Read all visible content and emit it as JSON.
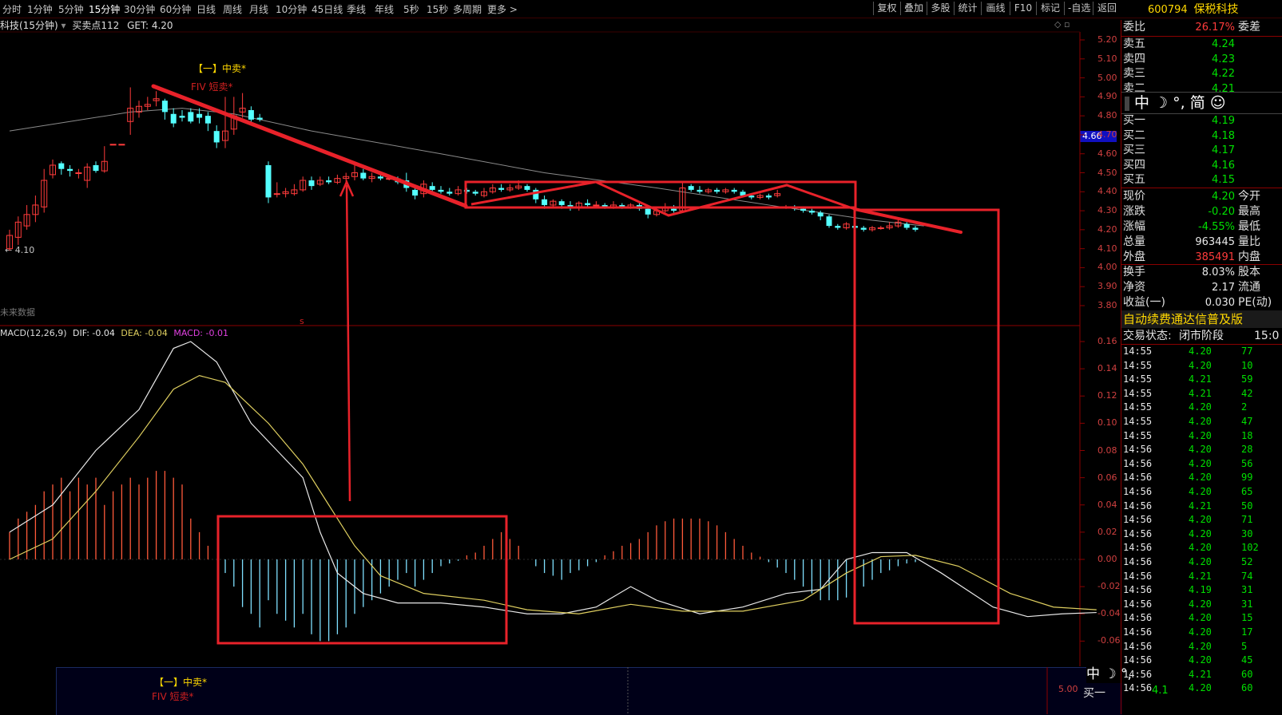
{
  "toolbar": {
    "periods": [
      "分时",
      "1分钟",
      "5分钟",
      "15分钟",
      "30分钟",
      "60分钟",
      "日线",
      "周线",
      "月线",
      "10分钟",
      "45日线",
      "季线",
      "年线",
      "5秒",
      "15秒",
      "多周期",
      "更多 >"
    ],
    "active_period": "15分钟",
    "tools": [
      "复权",
      "叠加",
      "多股",
      "统计",
      "画线",
      "F10",
      "标记",
      "-自选",
      "返回"
    ]
  },
  "stock": {
    "code": "600794",
    "name": "保税科技"
  },
  "chart": {
    "title": "科技(15分钟)",
    "indicator_label": "买卖点112",
    "get_label": "GET: 4.20",
    "low_mark": "4.10",
    "future_label": "未来数据",
    "signal_zhongmai": "【一】中卖*",
    "signal_duanmai": "FIV 短卖*",
    "price_tag": "4.66",
    "marker_s": "s",
    "price_axis": [
      "5.20",
      "5.10",
      "5.00",
      "4.90",
      "4.80",
      "4.70",
      "4.60",
      "4.50",
      "4.40",
      "4.30",
      "4.20",
      "4.10",
      "4.00",
      "3.90",
      "3.80"
    ],
    "macd_title": "MACD(12,26,9)",
    "dif": "DIF: -0.04",
    "dea": "DEA: -0.04",
    "macd": "MACD: -0.01",
    "macd_axis": [
      "0.16",
      "0.14",
      "0.12",
      "0.10",
      "0.08",
      "0.06",
      "0.04",
      "0.02",
      "0.00",
      "-0.02",
      "-0.04",
      "-0.06"
    ],
    "bottom_signal": "【一】中卖*",
    "bottom_signal2": "FIV 短卖*",
    "bottom_axis": "5.00",
    "bottom_mini": "中 ☽ °,",
    "bottom_buy1": "买一",
    "bottom_buy1_val": "4.1"
  },
  "colors": {
    "up": "#ff3b3b",
    "down": "#54ffff",
    "annotation": "#e8222a",
    "macd_dif": "#e8e8e8",
    "macd_dea": "#e0d060"
  },
  "candles": [
    [
      4.1,
      4.17,
      4.2,
      4.09
    ],
    [
      4.16,
      4.24,
      4.27,
      4.12
    ],
    [
      4.22,
      4.28,
      4.33,
      4.2
    ],
    [
      4.28,
      4.33,
      4.38,
      4.24
    ],
    [
      4.32,
      4.46,
      4.52,
      4.29
    ],
    [
      4.49,
      4.54,
      4.57,
      4.47
    ],
    [
      4.55,
      4.52,
      4.56,
      4.49
    ],
    [
      4.52,
      4.51,
      4.54,
      4.48
    ],
    [
      4.5,
      4.5,
      4.52,
      4.47
    ],
    [
      4.46,
      4.53,
      4.55,
      4.42
    ],
    [
      4.54,
      4.51,
      4.56,
      4.5
    ],
    [
      4.51,
      4.56,
      4.64,
      4.5
    ],
    [
      4.65,
      4.65,
      4.65,
      4.65
    ],
    [
      4.65,
      4.65,
      4.65,
      4.65
    ],
    [
      4.77,
      4.84,
      4.95,
      4.7
    ],
    [
      4.82,
      4.85,
      4.88,
      4.79
    ],
    [
      4.85,
      4.86,
      4.9,
      4.83
    ],
    [
      4.88,
      4.89,
      4.93,
      4.85
    ],
    [
      4.88,
      4.82,
      4.89,
      4.78
    ],
    [
      4.81,
      4.76,
      4.84,
      4.74
    ],
    [
      4.8,
      4.79,
      4.83,
      4.77
    ],
    [
      4.82,
      4.77,
      4.84,
      4.76
    ],
    [
      4.81,
      4.79,
      4.84,
      4.76
    ],
    [
      4.8,
      4.76,
      4.82,
      4.72
    ],
    [
      4.72,
      4.66,
      4.75,
      4.63
    ],
    [
      4.67,
      4.72,
      4.9,
      4.63
    ],
    [
      4.73,
      4.8,
      4.9,
      4.7
    ],
    [
      4.82,
      4.84,
      4.92,
      4.79
    ],
    [
      4.83,
      4.78,
      4.85,
      4.75
    ],
    [
      4.79,
      4.78,
      4.81,
      4.77
    ],
    [
      4.54,
      4.37,
      4.56,
      4.34
    ],
    [
      4.39,
      4.39,
      4.45,
      4.37
    ],
    [
      4.39,
      4.4,
      4.42,
      4.37
    ],
    [
      4.39,
      4.41,
      4.44,
      4.38
    ],
    [
      4.41,
      4.46,
      4.48,
      4.4
    ],
    [
      4.46,
      4.43,
      4.48,
      4.41
    ],
    [
      4.44,
      4.46,
      4.48,
      4.43
    ],
    [
      4.46,
      4.45,
      4.48,
      4.44
    ],
    [
      4.45,
      4.47,
      4.49,
      4.44
    ],
    [
      4.47,
      4.48,
      4.5,
      4.45
    ],
    [
      4.48,
      4.5,
      4.54,
      4.46
    ],
    [
      4.5,
      4.47,
      4.52,
      4.46
    ],
    [
      4.47,
      4.48,
      4.5,
      4.45
    ],
    [
      4.48,
      4.47,
      4.5,
      4.46
    ],
    [
      4.47,
      4.47,
      4.49,
      4.46
    ],
    [
      4.47,
      4.45,
      4.48,
      4.44
    ],
    [
      4.46,
      4.42,
      4.5,
      4.4
    ],
    [
      4.41,
      4.38,
      4.43,
      4.36
    ],
    [
      4.39,
      4.44,
      4.46,
      4.37
    ],
    [
      4.43,
      4.41,
      4.45,
      4.4
    ],
    [
      4.41,
      4.4,
      4.43,
      4.39
    ],
    [
      4.4,
      4.39,
      4.42,
      4.38
    ],
    [
      4.39,
      4.41,
      4.43,
      4.38
    ],
    [
      4.41,
      4.4,
      4.42,
      4.39
    ],
    [
      4.4,
      4.39,
      4.41,
      4.38
    ],
    [
      4.38,
      4.4,
      4.42,
      4.37
    ],
    [
      4.4,
      4.42,
      4.44,
      4.39
    ],
    [
      4.42,
      4.41,
      4.44,
      4.4
    ],
    [
      4.41,
      4.42,
      4.44,
      4.4
    ],
    [
      4.42,
      4.43,
      4.46,
      4.41
    ],
    [
      4.43,
      4.41,
      4.44,
      4.4
    ],
    [
      4.41,
      4.36,
      4.42,
      4.34
    ],
    [
      4.36,
      4.33,
      4.38,
      4.31
    ],
    [
      4.33,
      4.35,
      4.36,
      4.32
    ],
    [
      4.35,
      4.33,
      4.36,
      4.31
    ],
    [
      4.33,
      4.32,
      4.35,
      4.3
    ],
    [
      4.32,
      4.34,
      4.35,
      4.3
    ],
    [
      4.34,
      4.33,
      4.36,
      4.32
    ],
    [
      4.33,
      4.33,
      4.35,
      4.32
    ],
    [
      4.33,
      4.32,
      4.34,
      4.31
    ],
    [
      4.32,
      4.33,
      4.35,
      4.31
    ],
    [
      4.33,
      4.32,
      4.34,
      4.31
    ],
    [
      4.32,
      4.33,
      4.34,
      4.31
    ],
    [
      4.33,
      4.31,
      4.34,
      4.3
    ],
    [
      4.31,
      4.28,
      4.32,
      4.26
    ],
    [
      4.28,
      4.3,
      4.32,
      4.27
    ],
    [
      4.3,
      4.32,
      4.34,
      4.29
    ],
    [
      4.31,
      4.3,
      4.33,
      4.29
    ],
    [
      4.3,
      4.42,
      4.45,
      4.29
    ],
    [
      4.43,
      4.41,
      4.44,
      4.4
    ],
    [
      4.41,
      4.4,
      4.43,
      4.39
    ],
    [
      4.4,
      4.41,
      4.42,
      4.39
    ],
    [
      4.41,
      4.4,
      4.42,
      4.39
    ],
    [
      4.4,
      4.41,
      4.42,
      4.39
    ],
    [
      4.41,
      4.4,
      4.42,
      4.39
    ],
    [
      4.4,
      4.38,
      4.41,
      4.37
    ],
    [
      4.38,
      4.37,
      4.39,
      4.36
    ],
    [
      4.37,
      4.38,
      4.39,
      4.36
    ],
    [
      4.38,
      4.37,
      4.39,
      4.36
    ],
    [
      4.38,
      4.39,
      4.41,
      4.37
    ],
    [
      4.32,
      4.32,
      4.33,
      4.31
    ],
    [
      4.32,
      4.31,
      4.33,
      4.3
    ],
    [
      4.31,
      4.3,
      4.32,
      4.29
    ],
    [
      4.3,
      4.29,
      4.31,
      4.28
    ],
    [
      4.29,
      4.27,
      4.3,
      4.25
    ],
    [
      4.27,
      4.22,
      4.28,
      4.21
    ],
    [
      4.22,
      4.21,
      4.23,
      4.2
    ],
    [
      4.21,
      4.23,
      4.24,
      4.2
    ],
    [
      4.22,
      4.21,
      4.23,
      4.2
    ],
    [
      4.21,
      4.2,
      4.22,
      4.19
    ],
    [
      4.2,
      4.21,
      4.22,
      4.19
    ],
    [
      4.21,
      4.21,
      4.22,
      4.2
    ],
    [
      4.21,
      4.22,
      4.24,
      4.2
    ],
    [
      4.22,
      4.24,
      4.26,
      4.21
    ],
    [
      4.23,
      4.21,
      4.24,
      4.2
    ],
    [
      4.21,
      4.2,
      4.22,
      4.19
    ]
  ],
  "ma_line": [
    [
      0,
      4.72
    ],
    [
      7,
      4.77
    ],
    [
      14,
      4.82
    ],
    [
      20,
      4.84
    ],
    [
      26,
      4.81
    ],
    [
      35,
      4.72
    ],
    [
      50,
      4.6
    ],
    [
      62,
      4.5
    ],
    [
      75,
      4.42
    ],
    [
      88,
      4.33
    ],
    [
      100,
      4.25
    ],
    [
      106,
      4.22
    ]
  ],
  "macd_hist": [
    0.02,
    0.03,
    0.035,
    0.04,
    0.05,
    0.055,
    0.06,
    0.05,
    0.06,
    0.055,
    0.06,
    0.04,
    0.05,
    0.055,
    0.06,
    0.055,
    0.06,
    0.065,
    0.065,
    0.06,
    0.055,
    0.03,
    0.02,
    0.01,
    0.0,
    -0.01,
    -0.02,
    -0.035,
    -0.04,
    -0.05,
    -0.03,
    -0.04,
    -0.045,
    -0.05,
    -0.04,
    -0.055,
    -0.06,
    -0.06,
    -0.055,
    -0.05,
    -0.04,
    -0.035,
    -0.03,
    -0.025,
    -0.02,
    -0.015,
    -0.01,
    -0.02,
    -0.015,
    -0.01,
    -0.005,
    -0.003,
    -0.001,
    0.003,
    0.005,
    0.01,
    0.015,
    0.02,
    0.015,
    0.01,
    0.0,
    -0.005,
    -0.01,
    -0.012,
    -0.015,
    -0.01,
    -0.008,
    -0.005,
    -0.002,
    0.003,
    0.006,
    0.01,
    0.012,
    0.015,
    0.02,
    0.025,
    0.028,
    0.03,
    0.03,
    0.03,
    0.03,
    0.028,
    0.025,
    0.02,
    0.015,
    0.01,
    0.005,
    0.002,
    -0.002,
    -0.006,
    -0.01,
    -0.015,
    -0.02,
    -0.025,
    -0.03,
    -0.03,
    -0.03,
    -0.028,
    -0.025,
    -0.02,
    -0.015,
    -0.01,
    -0.008,
    -0.005,
    -0.003,
    -0.002
  ],
  "dif": [
    [
      0,
      0.02
    ],
    [
      5,
      0.04
    ],
    [
      10,
      0.08
    ],
    [
      15,
      0.11
    ],
    [
      19,
      0.155
    ],
    [
      21,
      0.16
    ],
    [
      24,
      0.145
    ],
    [
      28,
      0.1
    ],
    [
      31,
      0.08
    ],
    [
      34,
      0.06
    ],
    [
      36,
      0.02
    ],
    [
      38,
      -0.01
    ],
    [
      41,
      -0.025
    ],
    [
      45,
      -0.032
    ],
    [
      50,
      -0.032
    ],
    [
      55,
      -0.035
    ],
    [
      60,
      -0.04
    ],
    [
      64,
      -0.04
    ],
    [
      68,
      -0.035
    ],
    [
      72,
      -0.02
    ],
    [
      75,
      -0.03
    ],
    [
      80,
      -0.04
    ],
    [
      85,
      -0.035
    ],
    [
      90,
      -0.025
    ],
    [
      94,
      -0.022
    ],
    [
      97,
      0.0
    ],
    [
      100,
      0.005
    ],
    [
      104,
      0.005
    ],
    [
      108,
      -0.01
    ],
    [
      114,
      -0.035
    ],
    [
      118,
      -0.042
    ],
    [
      122,
      -0.04
    ],
    [
      126,
      -0.039
    ]
  ],
  "dea": [
    [
      0,
      0.0
    ],
    [
      5,
      0.015
    ],
    [
      10,
      0.05
    ],
    [
      15,
      0.09
    ],
    [
      19,
      0.125
    ],
    [
      22,
      0.135
    ],
    [
      25,
      0.13
    ],
    [
      30,
      0.1
    ],
    [
      34,
      0.07
    ],
    [
      37,
      0.04
    ],
    [
      40,
      0.01
    ],
    [
      43,
      -0.012
    ],
    [
      48,
      -0.025
    ],
    [
      55,
      -0.03
    ],
    [
      60,
      -0.037
    ],
    [
      66,
      -0.04
    ],
    [
      72,
      -0.033
    ],
    [
      78,
      -0.038
    ],
    [
      85,
      -0.038
    ],
    [
      92,
      -0.03
    ],
    [
      97,
      -0.01
    ],
    [
      101,
      0.002
    ],
    [
      105,
      0.003
    ],
    [
      110,
      -0.005
    ],
    [
      116,
      -0.025
    ],
    [
      121,
      -0.035
    ],
    [
      126,
      -0.037
    ]
  ],
  "orderbook": {
    "weibi": {
      "label": "委比",
      "value": "26.17%",
      "label2": "委差"
    },
    "sells": [
      {
        "label": "卖五",
        "price": "4.24"
      },
      {
        "label": "卖四",
        "price": "4.23"
      },
      {
        "label": "卖三",
        "price": "4.22"
      },
      {
        "label": "卖二",
        "price": "4.21"
      }
    ],
    "ime": "中 ☽ °, 简 ☺",
    "buys": [
      {
        "label": "买一",
        "price": "4.19"
      },
      {
        "label": "买二",
        "price": "4.18"
      },
      {
        "label": "买三",
        "price": "4.17"
      },
      {
        "label": "买四",
        "price": "4.16"
      },
      {
        "label": "买五",
        "price": "4.15"
      }
    ]
  },
  "quote": [
    {
      "k": "现价",
      "v": "4.20",
      "c": "green",
      "k2": "今开"
    },
    {
      "k": "涨跌",
      "v": "-0.20",
      "c": "green",
      "k2": "最高"
    },
    {
      "k": "涨幅",
      "v": "-4.55%",
      "c": "green",
      "k2": "最低"
    },
    {
      "k": "总量",
      "v": "963445",
      "c": "white",
      "k2": "量比"
    },
    {
      "k": "外盘",
      "v": "385491",
      "c": "redt",
      "k2": "内盘"
    },
    {
      "k": "换手",
      "v": "8.03%",
      "c": "white",
      "k2": "股本"
    },
    {
      "k": "净资",
      "v": "2.17",
      "c": "white",
      "k2": "流通"
    },
    {
      "k": "收益(一)",
      "v": "0.030",
      "c": "white",
      "k2": "PE(动)"
    }
  ],
  "banner": "自动续费通达信普及版",
  "trade_status": {
    "label": "交易状态:",
    "value": "闭市阶段",
    "time": "15:0"
  },
  "ticks": [
    {
      "t": "14:55",
      "p": "4.20",
      "v": "77",
      "c": "green"
    },
    {
      "t": "14:55",
      "p": "4.20",
      "v": "10",
      "c": "green"
    },
    {
      "t": "14:55",
      "p": "4.21",
      "v": "59",
      "c": "green"
    },
    {
      "t": "14:55",
      "p": "4.21",
      "v": "42",
      "c": "green"
    },
    {
      "t": "14:55",
      "p": "4.20",
      "v": "2",
      "c": "green"
    },
    {
      "t": "14:55",
      "p": "4.20",
      "v": "47",
      "c": "green"
    },
    {
      "t": "14:55",
      "p": "4.20",
      "v": "18",
      "c": "green"
    },
    {
      "t": "14:56",
      "p": "4.20",
      "v": "28",
      "c": "green"
    },
    {
      "t": "14:56",
      "p": "4.20",
      "v": "56",
      "c": "green"
    },
    {
      "t": "14:56",
      "p": "4.20",
      "v": "99",
      "c": "green"
    },
    {
      "t": "14:56",
      "p": "4.20",
      "v": "65",
      "c": "green"
    },
    {
      "t": "14:56",
      "p": "4.21",
      "v": "50",
      "c": "green"
    },
    {
      "t": "14:56",
      "p": "4.20",
      "v": "71",
      "c": "green"
    },
    {
      "t": "14:56",
      "p": "4.20",
      "v": "30",
      "c": "green"
    },
    {
      "t": "14:56",
      "p": "4.20",
      "v": "102",
      "c": "green"
    },
    {
      "t": "14:56",
      "p": "4.20",
      "v": "52",
      "c": "green"
    },
    {
      "t": "14:56",
      "p": "4.21",
      "v": "74",
      "c": "green"
    },
    {
      "t": "14:56",
      "p": "4.19",
      "v": "31",
      "c": "green"
    },
    {
      "t": "14:56",
      "p": "4.20",
      "v": "31",
      "c": "green"
    },
    {
      "t": "14:56",
      "p": "4.20",
      "v": "15",
      "c": "green"
    },
    {
      "t": "14:56",
      "p": "4.20",
      "v": "17",
      "c": "green"
    },
    {
      "t": "14:56",
      "p": "4.20",
      "v": "5",
      "c": "green"
    },
    {
      "t": "14:56",
      "p": "4.20",
      "v": "45",
      "c": "green"
    },
    {
      "t": "14:56",
      "p": "4.21",
      "v": "60",
      "c": "green"
    },
    {
      "t": "14:56",
      "p": "4.20",
      "v": "60",
      "c": "green"
    }
  ]
}
